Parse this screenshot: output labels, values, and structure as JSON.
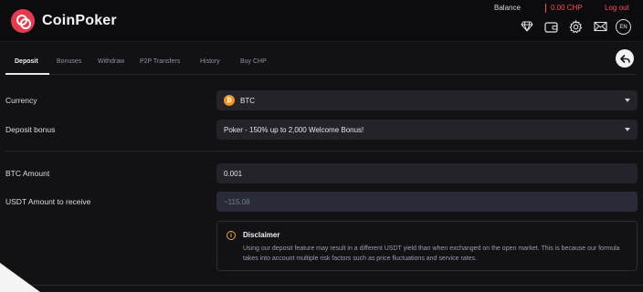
{
  "header": {
    "brand": "CoinPoker",
    "balance_label": "Balance",
    "balance_value": "0.00 CHP",
    "logout": "Log out",
    "icons": [
      "diamond-icon",
      "wallet-icon",
      "gear-icon",
      "mail-icon"
    ],
    "language": "EN"
  },
  "tabs": [
    {
      "label": "Deposit",
      "active": true
    },
    {
      "label": "Bonuses"
    },
    {
      "label": "Withdraw"
    },
    {
      "label": "P2P Transfers"
    },
    {
      "label": "History"
    },
    {
      "label": "Buy CHP"
    }
  ],
  "form": {
    "currency_label": "Currency",
    "currency_value": "BTC",
    "bonus_label": "Deposit bonus",
    "bonus_value": "Poker - 150% up to 2,000 Welcome Bonus!",
    "amount_label": "BTC Amount",
    "amount_value": "0.001",
    "receive_label": "USDT Amount to receive",
    "receive_value": "~115.08"
  },
  "disclaimer": {
    "title": "Disclaimer",
    "text": "Using our deposit feature may result in a different USDT yield than when exchanged on the open market. This is because our formula takes into account multiple risk factors such as price fluctuations and service rates."
  },
  "colors": {
    "accent": "#e63a4d",
    "balance_red": "#ff4b5c",
    "btc_orange": "#f7931a",
    "warning": "#f0a53a"
  }
}
